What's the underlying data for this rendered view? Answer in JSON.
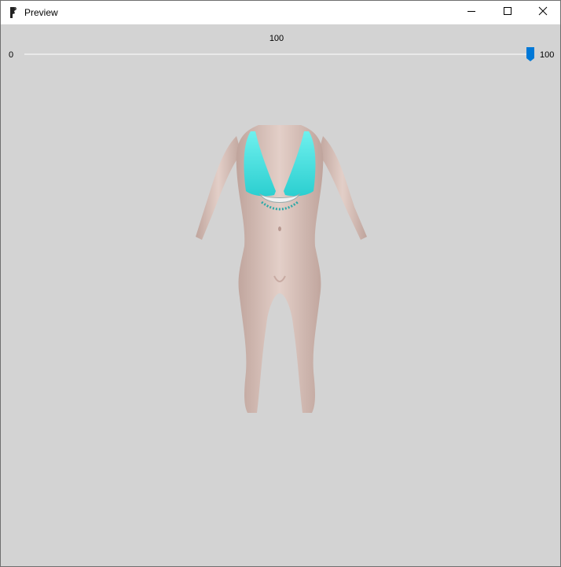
{
  "window": {
    "title": "Preview",
    "icon": "app-icon",
    "controls": [
      "minimize-icon",
      "maximize-icon",
      "close-icon"
    ]
  },
  "slider": {
    "current_value": "100",
    "min_label": "0",
    "max_label": "100",
    "level": 1.0,
    "accent_color": "#0078d7"
  },
  "viewport": {
    "background_color": "#d3d3d3",
    "content": "3d-body-preview",
    "outfit_color": "#49e3e0"
  }
}
